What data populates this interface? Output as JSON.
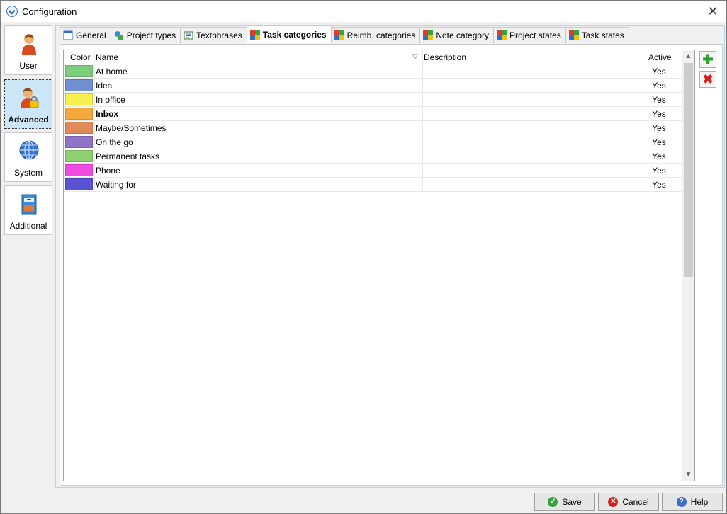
{
  "window": {
    "title": "Configuration"
  },
  "sidebar": {
    "items": [
      {
        "label": "User",
        "icon": "user-icon"
      },
      {
        "label": "Advanced",
        "icon": "user-lock-icon"
      },
      {
        "label": "System",
        "icon": "globe-icon"
      },
      {
        "label": "Additional",
        "icon": "cabinet-icon"
      }
    ]
  },
  "tabs": [
    {
      "label": "General"
    },
    {
      "label": "Project types"
    },
    {
      "label": "Textphrases"
    },
    {
      "label": "Task categories"
    },
    {
      "label": "Reimb. categories"
    },
    {
      "label": "Note category"
    },
    {
      "label": "Project states"
    },
    {
      "label": "Task states"
    }
  ],
  "table": {
    "columns": {
      "color": "Color",
      "name": "Name",
      "description": "Description",
      "active": "Active"
    },
    "rows": [
      {
        "color": "#7ccd7c",
        "name": "At home",
        "description": "",
        "active": "Yes"
      },
      {
        "color": "#6f8fd0",
        "name": "Idea",
        "description": "",
        "active": "Yes"
      },
      {
        "color": "#f5ef4e",
        "name": "In office",
        "description": "",
        "active": "Yes"
      },
      {
        "color": "#f5a83b",
        "name": "Inbox",
        "description": "",
        "active": "Yes"
      },
      {
        "color": "#e08a5a",
        "name": "Maybe/Sometimes",
        "description": "",
        "active": "Yes"
      },
      {
        "color": "#8f73c6",
        "name": "On the go",
        "description": "",
        "active": "Yes"
      },
      {
        "color": "#8ed070",
        "name": "Permanent tasks",
        "description": "",
        "active": "Yes"
      },
      {
        "color": "#f04ce0",
        "name": "Phone",
        "description": "",
        "active": "Yes"
      },
      {
        "color": "#5a52d6",
        "name": "Waiting for",
        "description": "",
        "active": "Yes"
      }
    ]
  },
  "buttons": {
    "save": "Save",
    "cancel": "Cancel",
    "help": "Help"
  }
}
